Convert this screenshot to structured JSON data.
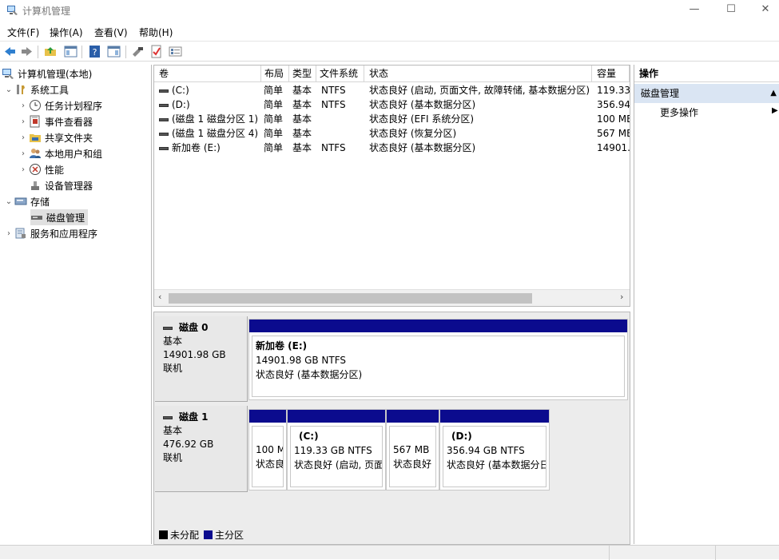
{
  "window": {
    "title": "计算机管理",
    "minimize": "—",
    "maximize": "☐",
    "close": "✕"
  },
  "menu": [
    "文件(F)",
    "操作(A)",
    "查看(V)",
    "帮助(H)"
  ],
  "tree": {
    "root": "计算机管理(本地)",
    "system_tools": "系统工具",
    "task_scheduler": "任务计划程序",
    "event_viewer": "事件查看器",
    "shared_folders": "共享文件夹",
    "local_users": "本地用户和组",
    "performance": "性能",
    "device_manager": "设备管理器",
    "storage": "存储",
    "disk_management": "磁盘管理",
    "services": "服务和应用程序"
  },
  "volume_table": {
    "headers": [
      "卷",
      "布局",
      "类型",
      "文件系统",
      "状态",
      "容量"
    ],
    "rows": [
      [
        "(C:)",
        "简单",
        "基本",
        "NTFS",
        "状态良好 (启动, 页面文件, 故障转储, 基本数据分区)",
        "119.33"
      ],
      [
        "(D:)",
        "简单",
        "基本",
        "NTFS",
        "状态良好 (基本数据分区)",
        "356.94"
      ],
      [
        "(磁盘 1 磁盘分区 1)",
        "简单",
        "基本",
        "",
        "状态良好 (EFI 系统分区)",
        "100 ME"
      ],
      [
        "(磁盘 1 磁盘分区 4)",
        "简单",
        "基本",
        "",
        "状态良好 (恢复分区)",
        "567 ME"
      ],
      [
        "新加卷 (E:)",
        "简单",
        "基本",
        "NTFS",
        "状态良好 (基本数据分区)",
        "14901.9"
      ]
    ]
  },
  "disks": {
    "disk0": {
      "name": "磁盘 0",
      "type": "基本",
      "size": "14901.98 GB",
      "status": "联机",
      "partitions": [
        {
          "name": "新加卷 (E:)",
          "size": "14901.98 GB NTFS",
          "status": "状态良好 (基本数据分区)"
        }
      ]
    },
    "disk1": {
      "name": "磁盘 1",
      "type": "基本",
      "size": "476.92 GB",
      "status": "联机",
      "partitions": [
        {
          "name": "",
          "size": "100 M",
          "status": "状态良"
        },
        {
          "name": "(C:)",
          "size": "119.33 GB NTFS",
          "status": "状态良好 (启动, 页面"
        },
        {
          "name": "",
          "size": "567 MB",
          "status": "状态良好"
        },
        {
          "name": "(D:)",
          "size": "356.94 GB NTFS",
          "status": "状态良好 (基本数据分日"
        }
      ]
    }
  },
  "legend": {
    "unallocated": "未分配",
    "primary": "主分区"
  },
  "colors": {
    "primary_partition": "#0b0b8e",
    "unallocated": "#000000",
    "action_section": "#dae5f3"
  },
  "actions": {
    "header": "操作",
    "section": "磁盘管理",
    "more": "更多操作"
  }
}
